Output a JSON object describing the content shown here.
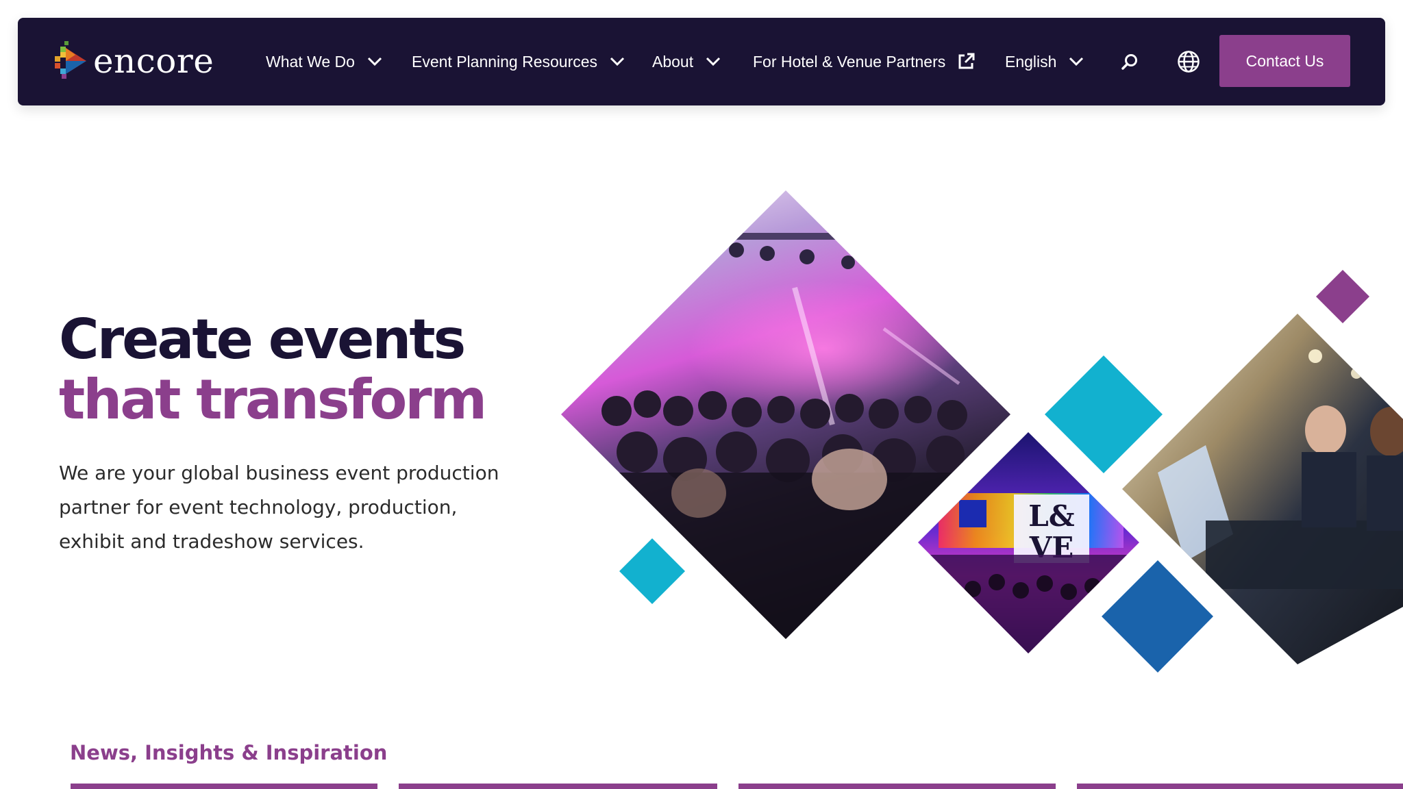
{
  "nav": {
    "logo_text": "encore",
    "items": [
      {
        "label": "What We Do"
      },
      {
        "label": "Event Planning Resources"
      },
      {
        "label": "About"
      },
      {
        "label": "For Hotel & Venue Partners"
      },
      {
        "label": "English"
      }
    ],
    "contact_label": "Contact Us",
    "background": "#1a1334"
  },
  "hero": {
    "title_line1": "Create events",
    "title_line2": "that transform",
    "description": "We are your global business event production partner for event technology, production, exhibit and tradeshow services."
  },
  "news": {
    "heading": "News, Insights & Inspiration"
  },
  "colors": {
    "accent_purple": "#8b3f8c",
    "navy": "#1a1334",
    "teal": "#12b1cf",
    "blue": "#1a63ab"
  },
  "collage": {
    "photos": [
      "concert-crowd-photo",
      "love-stage-photo",
      "av-technicians-photo"
    ],
    "decor": [
      "teal-diamond",
      "blue-diamond",
      "purple-diamond"
    ]
  }
}
